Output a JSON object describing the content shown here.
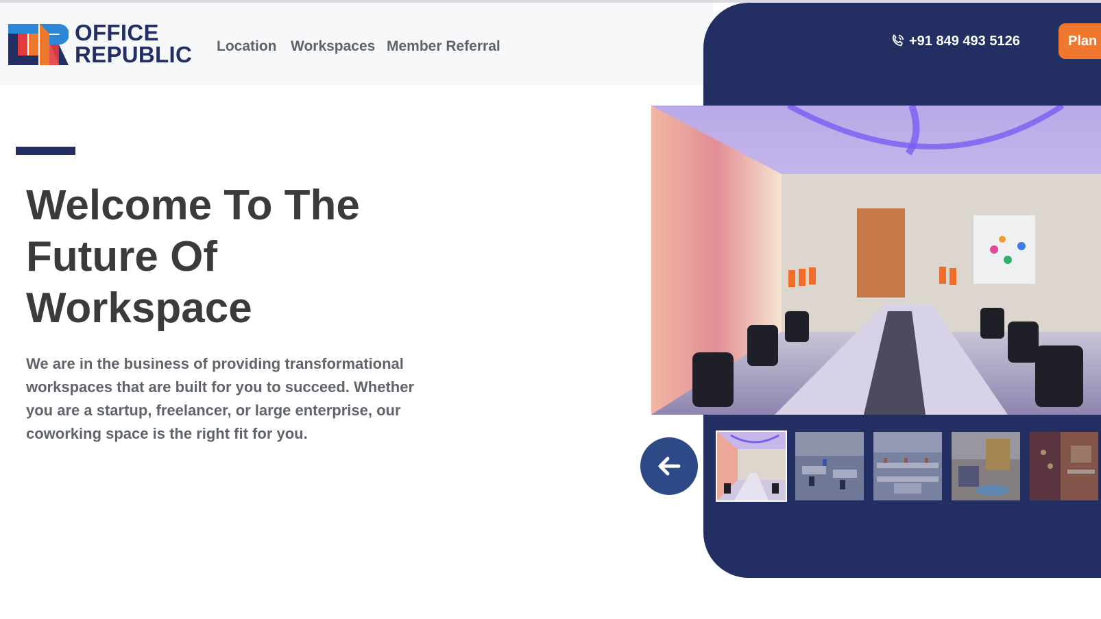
{
  "brand": {
    "name_line1": "OFFICE",
    "name_line2": "REPUBLIC",
    "colors": {
      "navy": "#232e63",
      "orange": "#f0782e",
      "blue": "#2d87d8",
      "red": "#e23b3b"
    }
  },
  "nav": {
    "items": [
      {
        "label": "Location"
      },
      {
        "label": "Workspaces"
      },
      {
        "label": "Member Referral"
      }
    ]
  },
  "header": {
    "phone_icon": "phone-icon",
    "phone": "+91 849 493 5126",
    "cta_label": "Plan A"
  },
  "hero": {
    "title_lines": [
      "Welcome To The",
      "Future Of",
      "Workspace"
    ],
    "description": "We are in the business of providing transformational workspaces that are built for you to succeed. Whether you are a startup, freelancer, or large enterprise, our coworking space is the right fit for you."
  },
  "gallery": {
    "prev_icon": "arrow-left-icon",
    "main_image": "conference-room-photo",
    "thumbnails": [
      {
        "image": "conference-room-thumbnail",
        "active": true
      },
      {
        "image": "open-office-thumbnail",
        "active": false
      },
      {
        "image": "workstations-thumbnail",
        "active": false
      },
      {
        "image": "lounge-thumbnail",
        "active": false
      },
      {
        "image": "cafe-thumbnail",
        "active": false
      }
    ]
  }
}
